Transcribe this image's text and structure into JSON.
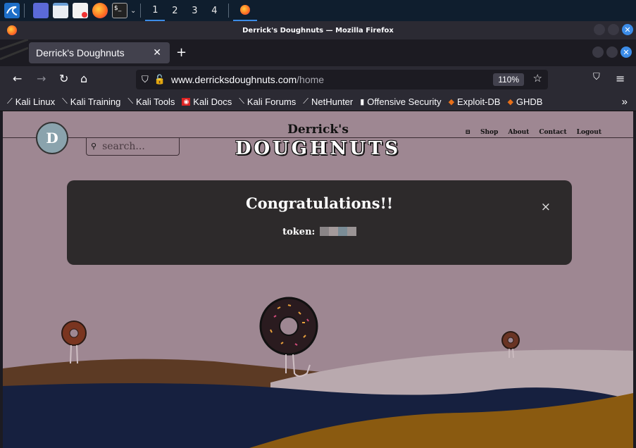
{
  "taskbar": {
    "workspaces": [
      "1",
      "2",
      "3",
      "4"
    ],
    "active_workspace": "1"
  },
  "window": {
    "title": "Derrick's Doughnuts — Mozilla Firefox"
  },
  "tab": {
    "title": "Derrick's Doughnuts"
  },
  "urlbar": {
    "host": "www.derricksdoughnuts.com",
    "path": "/home",
    "zoom": "110%"
  },
  "bookmarks": [
    {
      "label": "Kali Linux",
      "icon": "kali-dragon-icon"
    },
    {
      "label": "Kali Training",
      "icon": "kali-dragon-icon"
    },
    {
      "label": "Kali Tools",
      "icon": "kali-dragon-icon"
    },
    {
      "label": "Kali Docs",
      "icon": "kali-docs-icon"
    },
    {
      "label": "Kali Forums",
      "icon": "kali-dragon-icon"
    },
    {
      "label": "NetHunter",
      "icon": "nethunter-icon"
    },
    {
      "label": "Offensive Security",
      "icon": "offsec-icon"
    },
    {
      "label": "Exploit-DB",
      "icon": "exploitdb-icon"
    },
    {
      "label": "GHDB",
      "icon": "exploitdb-icon"
    }
  ],
  "site": {
    "brand_line1": "Derrick's",
    "brand_line2": "DOUGHNUTS",
    "logo_letter": "D",
    "search_placeholder": "search...",
    "nav": [
      "Shop",
      "About",
      "Contact",
      "Logout"
    ]
  },
  "modal": {
    "title": "Congratulations!!",
    "token_label": "token:",
    "close": "×"
  },
  "colors": {
    "page_bg": "#9e8792",
    "modal_bg": "#2d2a2b",
    "accent_blue": "#3c8ce7",
    "hill_navy": "#16203f",
    "hill_mustard": "#8a5a10",
    "hill_brown": "#5c3a24"
  }
}
